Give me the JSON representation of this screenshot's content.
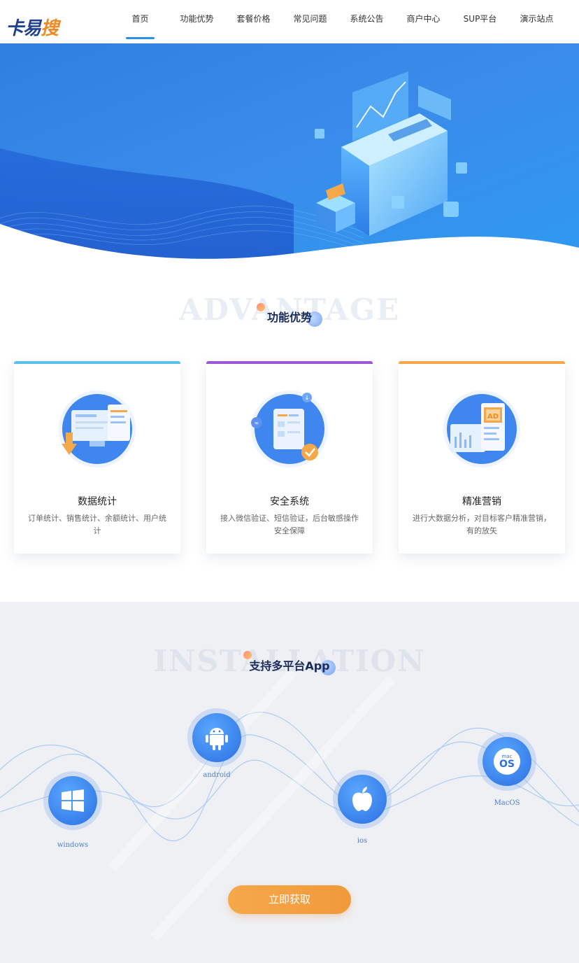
{
  "brand": {
    "logo_text_1": "卡易",
    "logo_text_2": "搜"
  },
  "nav": {
    "items": [
      {
        "label": "首页",
        "active": true
      },
      {
        "label": "功能优势"
      },
      {
        "label": "套餐价格"
      },
      {
        "label": "常见问题"
      },
      {
        "label": "系统公告"
      },
      {
        "label": "商户中心"
      },
      {
        "label": "SUP平台"
      },
      {
        "label": "演示站点"
      }
    ]
  },
  "advantage": {
    "bg_text": "ADVANTAGE",
    "title": "功能优势",
    "cards": [
      {
        "title": "数据统计",
        "desc": "订单统计、销售统计、余额统计、用户统计",
        "accent": "#5bc0eb"
      },
      {
        "title": "安全系统",
        "desc": "接入微信验证、短信验证，后台敏感操作安全保障",
        "accent": "#9b59d6"
      },
      {
        "title": "精准营销",
        "desc": "进行大数据分析，对目标客户精准营销，有的放矢",
        "accent": "#f5a84a"
      }
    ]
  },
  "installation": {
    "bg_text": "INSTALLATION",
    "title": "支持多平台App",
    "platforms": [
      {
        "label": "windows",
        "icon": "windows-icon"
      },
      {
        "label": "android",
        "icon": "android-icon"
      },
      {
        "label": "ios",
        "icon": "apple-icon"
      },
      {
        "label": "MacOS",
        "icon": "macos-icon"
      }
    ],
    "mac_icon_small": "mac",
    "mac_icon_big": "OS",
    "cta_label": "立即获取"
  },
  "colors": {
    "primary": "#2d8fe6",
    "cta": "#f5a84a",
    "title": "#1a2b5c"
  }
}
